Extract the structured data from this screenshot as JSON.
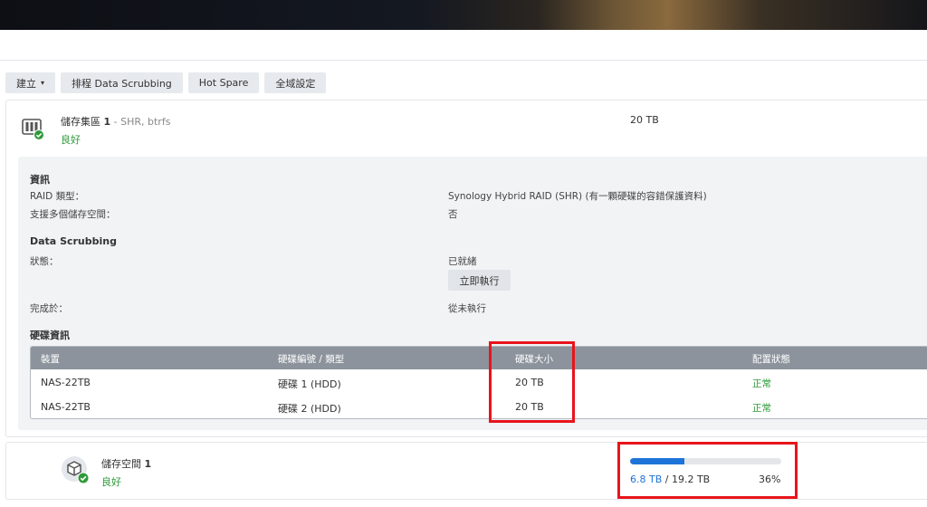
{
  "toolbar": {
    "create_label": "建立",
    "create_caret": "▾",
    "schedule_label": "排程 Data Scrubbing",
    "hotspare_label": "Hot Spare",
    "global_label": "全域設定"
  },
  "pool": {
    "title_prefix": "儲存集區",
    "title_num": "1",
    "title_sub": " - SHR, btrfs",
    "status": "良好",
    "size": "20 TB",
    "info_heading": "資訊",
    "raid_label": "RAID 類型：",
    "raid_value": "Synology Hybrid RAID (SHR) (有一顆硬碟的容錯保護資料)",
    "multi_label": "支援多個儲存空間：",
    "multi_value": "否",
    "scrub_heading": "Data Scrubbing",
    "state_label": "狀態：",
    "state_value": "已就緒",
    "run_now_label": "立即執行",
    "done_label": "完成於：",
    "done_value": "從未執行",
    "disk_heading": "硬碟資訊",
    "table": {
      "headers": [
        "裝置",
        "硬碟編號 / 類型",
        "硬碟大小",
        "配置狀態"
      ],
      "rows": [
        [
          "NAS-22TB",
          "硬碟 1 (HDD)",
          "20 TB",
          "正常"
        ],
        [
          "NAS-22TB",
          "硬碟 2 (HDD)",
          "20 TB",
          "正常"
        ]
      ]
    }
  },
  "volume": {
    "title_prefix": "儲存空間",
    "title_num": "1",
    "status": "良好",
    "used": "6.8 TB",
    "separator": " / ",
    "total": "19.2 TB",
    "percent_label": "36%",
    "usage_fraction": 0.36
  },
  "colors": {
    "status_ok": "#2e9a3a",
    "accent_blue": "#1e73d8",
    "highlight_red": "#e8141b",
    "table_header": "#8c939c"
  },
  "icons": {
    "pool": "storage-pool-icon",
    "volume": "volume-cube-icon",
    "healthy_badge": "check-badge-icon"
  }
}
